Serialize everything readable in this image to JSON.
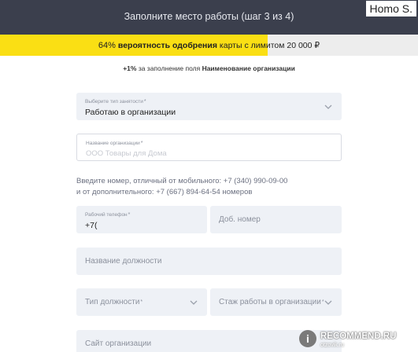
{
  "header": {
    "title": "Заполните место работы (шаг 3 из 4)"
  },
  "watermark_top": "Homo S.",
  "progress": {
    "percent": 64,
    "percent_text": "64%",
    "bold_text": "вероятность одобрения",
    "rest_text": "карты с лимитом 20 000 ₽",
    "fill_color": "#fadf14"
  },
  "hint": {
    "prefix": "+1%",
    "middle": "за заполнение поля",
    "field_name": "Наименование организации"
  },
  "form": {
    "employment_type": {
      "label": "Выберите тип занятости",
      "req": "*",
      "value": "Работаю в организации"
    },
    "org_name": {
      "label": "Название организации",
      "req": "*",
      "placeholder": "ООО Товары для Дома"
    },
    "info_line1": "Введите номер, отличный от мобильного: +7 (340) 990-09-00",
    "info_line2": "и от дополнительного: +7 (667) 894-64-54 номеров",
    "work_phone": {
      "label": "Рабочий телефон",
      "req": "*",
      "value": "+7("
    },
    "extension": {
      "placeholder": "Доб. номер"
    },
    "position_name": {
      "placeholder": "Название должности"
    },
    "position_type": {
      "placeholder": "Тип должности",
      "req": "*"
    },
    "work_experience": {
      "placeholder": "Стаж работы в организации",
      "req": "*"
    },
    "org_site": {
      "placeholder": "Сайт организации"
    }
  },
  "watermark": {
    "badge": "i",
    "text": "RECOMMEND.RU",
    "sub": "otzovik.ru"
  },
  "colors": {
    "header_bg": "#3b3f4d",
    "field_bg": "#eef1f6",
    "accent": "#fadf14"
  }
}
